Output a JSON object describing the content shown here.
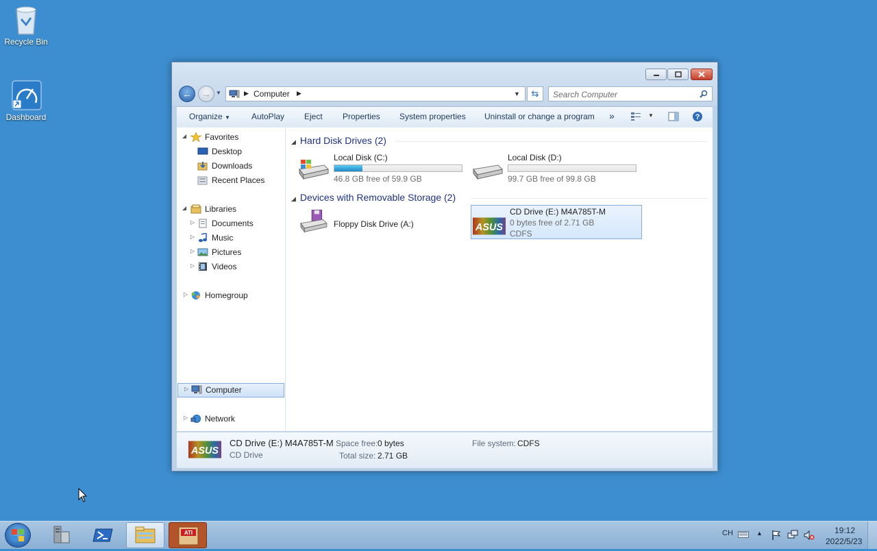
{
  "desktop": {
    "icons": [
      {
        "label": "Recycle Bin",
        "icon": "recycle-bin-icon"
      },
      {
        "label": "Dashboard",
        "icon": "dashboard-gauge-icon"
      }
    ]
  },
  "window": {
    "address": {
      "crumbs": [
        "Computer"
      ]
    },
    "search": {
      "placeholder": "Search Computer"
    },
    "toolbar": {
      "organize": "Organize",
      "autoplay": "AutoPlay",
      "eject": "Eject",
      "properties": "Properties",
      "system_properties": "System properties",
      "uninstall": "Uninstall or change a program",
      "more": "»"
    },
    "navpane": {
      "favorites": {
        "label": "Favorites",
        "items": [
          "Desktop",
          "Downloads",
          "Recent Places"
        ]
      },
      "libraries": {
        "label": "Libraries",
        "items": [
          "Documents",
          "Music",
          "Pictures",
          "Videos"
        ]
      },
      "homegroup": "Homegroup",
      "computer": "Computer",
      "network": "Network"
    },
    "content": {
      "hard_disk_header": "Hard Disk Drives (2)",
      "removable_header": "Devices with Removable Storage (2)",
      "drives": [
        {
          "name": "Local Disk (C:)",
          "free": "46.8 GB free of 59.9 GB",
          "used_fraction": 0.22
        },
        {
          "name": "Local Disk (D:)",
          "free": "99.7 GB free of 99.8 GB",
          "used_fraction": 0.001
        }
      ],
      "removable": [
        {
          "name": "Floppy Disk Drive (A:)"
        },
        {
          "name": "CD Drive (E:) M4A785T-M",
          "free": "0 bytes free of 2.71 GB",
          "fs": "CDFS",
          "logo_text": "ASUS"
        }
      ]
    },
    "details": {
      "name": "CD Drive (E:) M4A785T-M",
      "type": "CD Drive",
      "space_free_label": "Space free:",
      "space_free": "0 bytes",
      "total_size_label": "Total size:",
      "total_size": "2.71 GB",
      "fs_label": "File system:",
      "fs": "CDFS",
      "logo_text": "ASUS"
    }
  },
  "taskbar": {
    "lang": "CH",
    "time": "19:12",
    "date": "2022/5/23",
    "buttons": [
      "server-manager-icon",
      "powershell-icon",
      "windows-explorer-icon",
      "ati-catalyst-icon"
    ]
  }
}
